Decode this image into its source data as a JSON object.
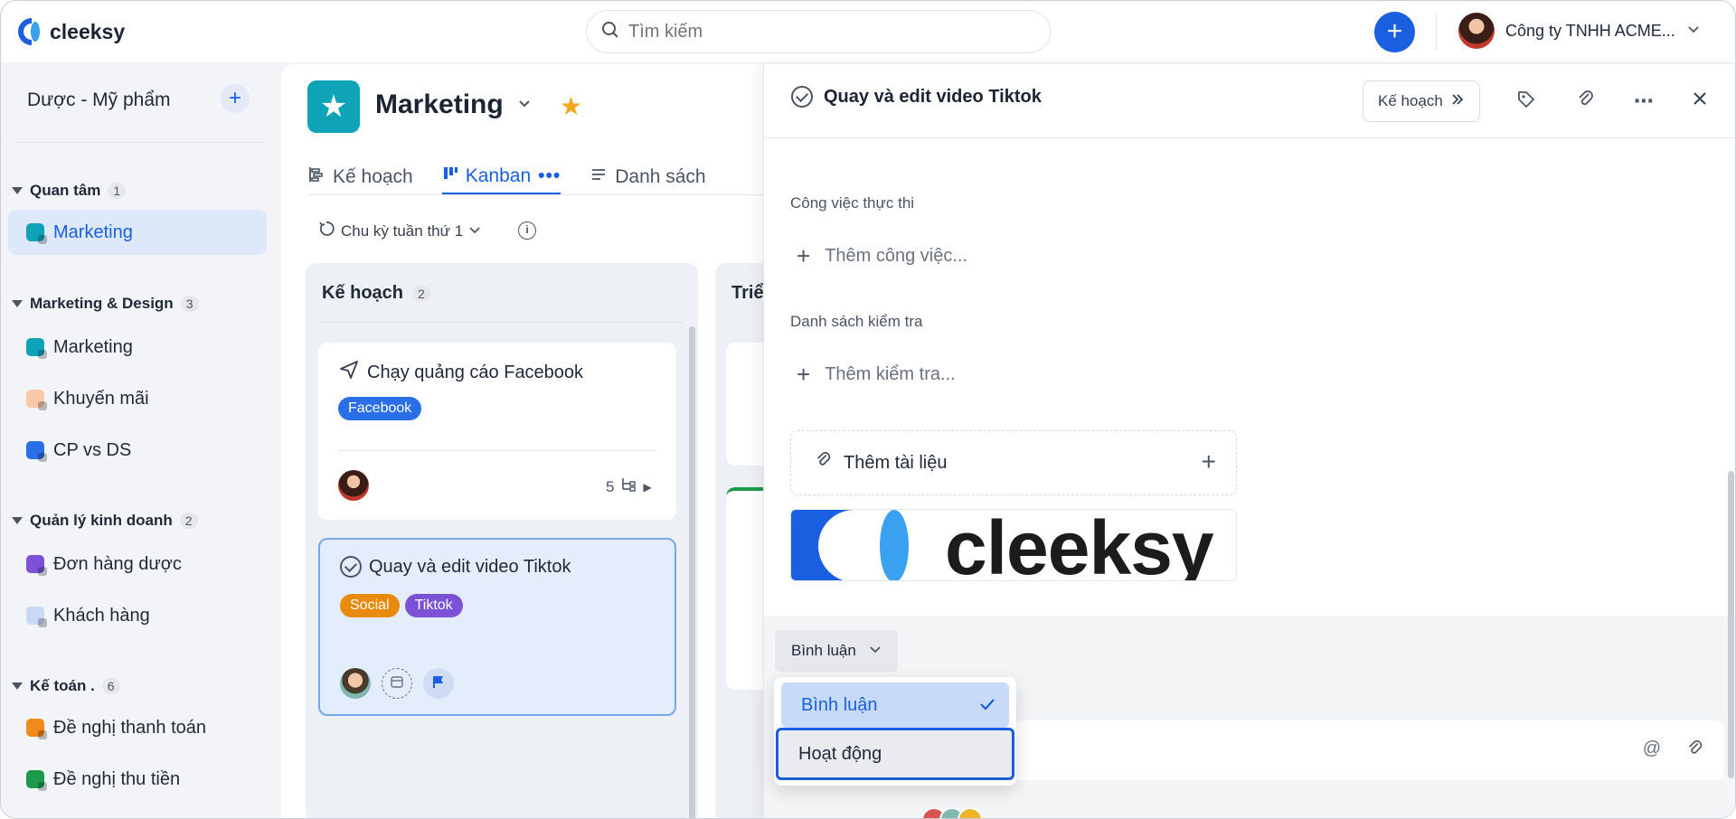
{
  "app": {
    "name": "cleeksy"
  },
  "search": {
    "placeholder": "Tìm kiếm"
  },
  "account": {
    "company": "Công ty TNHH ACME..."
  },
  "sidebar": {
    "workspace": "Dược - Mỹ phẩm",
    "groups": [
      {
        "name": "Quan tâm",
        "count": "1",
        "items": [
          {
            "label": "Marketing",
            "color": "#0fa3b8",
            "active": true
          }
        ]
      },
      {
        "name": "Marketing & Design",
        "count": "3",
        "items": [
          {
            "label": "Marketing",
            "color": "#0fa3b8"
          },
          {
            "label": "Khuyến mãi",
            "color": "#f8c8a8"
          },
          {
            "label": "CP vs DS",
            "color": "#2a6ee8"
          }
        ]
      },
      {
        "name": "Quản lý kinh doanh",
        "count": "2",
        "items": [
          {
            "label": "Đơn hàng dược",
            "color": "#7b52d6"
          },
          {
            "label": "Khách hàng",
            "color": "#c9d8f5"
          }
        ]
      },
      {
        "name": "Kế toán .",
        "count": "6",
        "items": [
          {
            "label": "Đề nghị thanh toán",
            "color": "#f08a1a"
          },
          {
            "label": "Đề nghị thu tiền",
            "color": "#1a9a4a"
          }
        ]
      }
    ]
  },
  "project": {
    "title": "Marketing",
    "tabs": [
      {
        "label": "Kế hoạch"
      },
      {
        "label": "Kanban"
      },
      {
        "label": "Danh sách"
      }
    ],
    "cycle": "Chu kỳ tuần thứ 1"
  },
  "board": {
    "columns": [
      {
        "title": "Kế hoạch",
        "count": "2",
        "cards": [
          {
            "title": "Chạy quảng cáo Facebook",
            "tags": [
              {
                "label": "Facebook",
                "color": "#2a6ee8"
              }
            ],
            "subtasks": "5"
          },
          {
            "title": "Quay và edit video Tiktok",
            "tags": [
              {
                "label": "Social",
                "color": "#e88a0c"
              },
              {
                "label": "Tiktok",
                "color": "#7b52d6"
              }
            ]
          }
        ]
      },
      {
        "title": "Triể"
      }
    ]
  },
  "panel": {
    "title": "Quay và edit video Tiktok",
    "status": "Kế hoạch",
    "sections": {
      "tasks_label": "Công việc thực thi",
      "tasks_add": "Thêm công việc...",
      "checklist_label": "Danh sách kiểm tra",
      "checklist_add": "Thêm kiểm tra...",
      "attach_label": "Thêm tài liệu"
    },
    "banner_text": "cleeksy",
    "comments": {
      "filter": "Bình luận",
      "options": [
        {
          "label": "Bình luận",
          "selected": true
        },
        {
          "label": "Hoạt động",
          "focused": true
        }
      ]
    }
  }
}
